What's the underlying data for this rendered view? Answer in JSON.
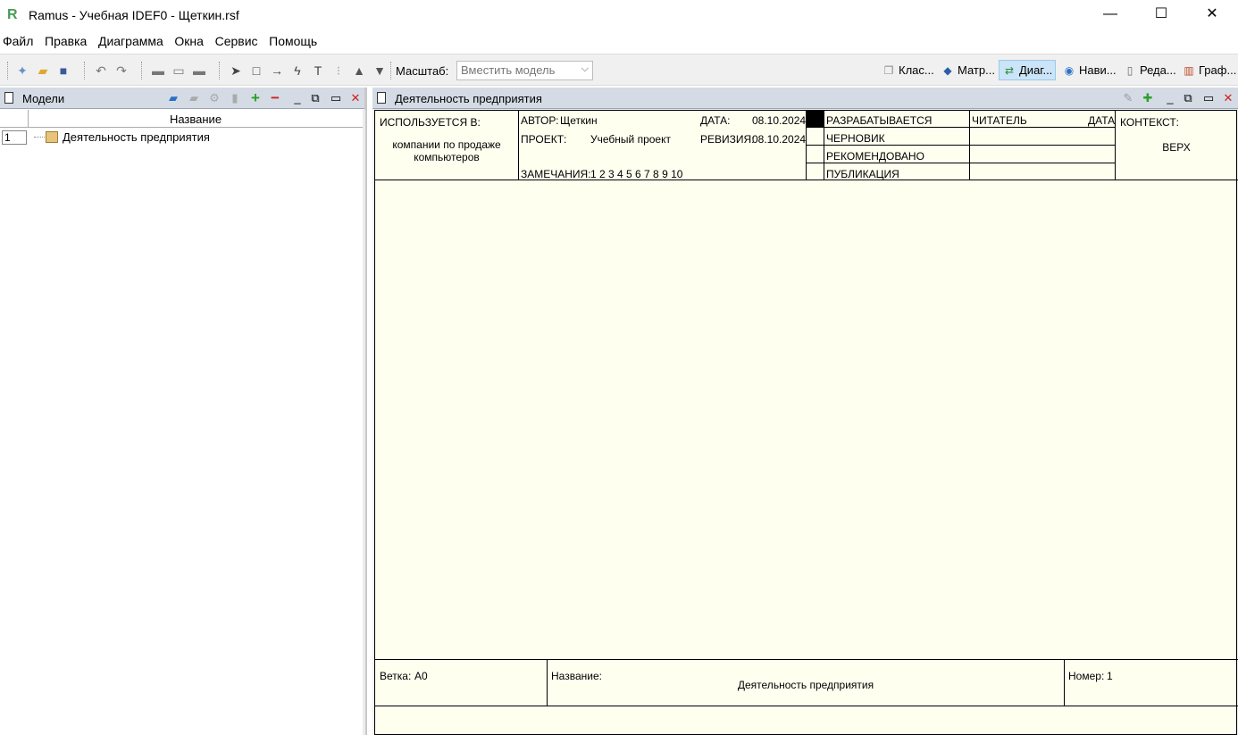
{
  "window": {
    "title": "Ramus - Учебная IDEF0 - Щеткин.rsf",
    "minimize": "—",
    "maximize": "☐",
    "close": "✕"
  },
  "menu": [
    "Файл",
    "Правка",
    "Диаграмма",
    "Окна",
    "Сервис",
    "Помощь"
  ],
  "toolbar": {
    "zoom_label": "Масштаб:",
    "zoom_value": "Вместить модель",
    "tabs": [
      {
        "label": "Клас...",
        "icon": "classes-icon"
      },
      {
        "label": "Матр...",
        "icon": "matrix-icon"
      },
      {
        "label": "Диаг...",
        "icon": "diagram-icon",
        "active": true
      },
      {
        "label": "Нави...",
        "icon": "navigator-icon"
      },
      {
        "label": "Реда...",
        "icon": "editor-icon"
      },
      {
        "label": "Граф...",
        "icon": "graph-icon"
      }
    ]
  },
  "left_panel": {
    "title": "Модели",
    "column_name": "Название",
    "rows": [
      {
        "num": "1",
        "label": "Деятельность предприятия"
      }
    ]
  },
  "right_panel": {
    "title": "Деятельность предприятия"
  },
  "frame": {
    "used_in_label": "ИСПОЛЬЗУЕТСЯ В:",
    "used_in_value_line1": "компании по продаже",
    "used_in_value_line2": "компьютеров",
    "author_label": "АВТОР:",
    "author_value": "Щеткин",
    "project_label": "ПРОЕКТ:",
    "project_value": "Учебный проект",
    "date_label": "ДАТА:",
    "date_value": "08.10.2024",
    "revision_label": "РЕВИЗИЯ:",
    "revision_value": "08.10.2024",
    "notes_label": "ЗАМЕЧАНИЯ:",
    "notes_value": "1 2 3 4 5 6 7 8 9 10",
    "status": [
      "РАЗРАБАТЫВАЕТСЯ",
      "ЧЕРНОВИК",
      "РЕКОМЕНДОВАНО",
      "ПУБЛИКАЦИЯ"
    ],
    "reader_label": "ЧИТАТЕЛЬ",
    "reader_date_label": "ДАТА",
    "context_label": "КОНТЕКСТ:",
    "context_value": "ВЕРХ",
    "node_label": "Ветка:",
    "node_value": "A0",
    "name_label": "Название:",
    "name_value": "Деятельность предприятия",
    "number_label": "Номер:",
    "number_value": "1"
  }
}
